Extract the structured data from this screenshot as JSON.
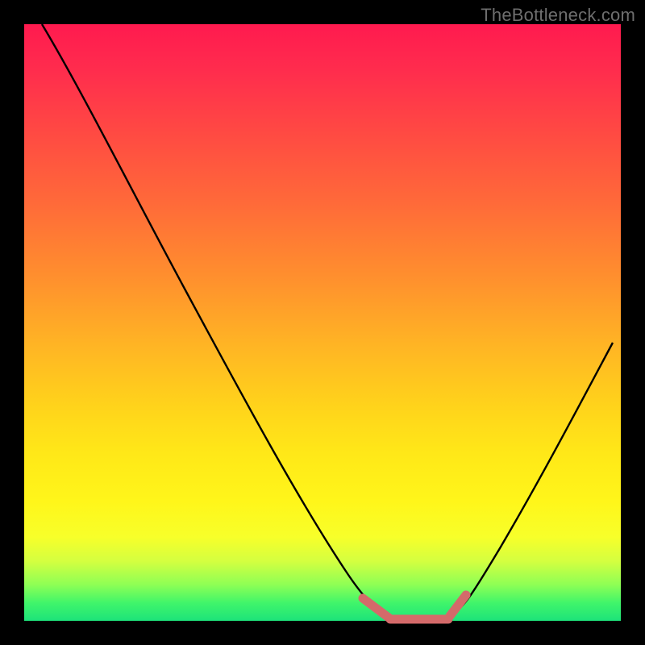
{
  "watermark": "TheBottleneck.com",
  "colors": {
    "curve": "#000000",
    "marker": "#d46a6a",
    "frame_bg": "#000000"
  },
  "chart_data": {
    "type": "line",
    "title": "",
    "xlabel": "",
    "ylabel": "",
    "xlim": [
      0,
      100
    ],
    "ylim": [
      0,
      100
    ],
    "series": [
      {
        "name": "bottleneck-curve",
        "x": [
          3,
          10,
          20,
          30,
          40,
          50,
          55,
          58,
          60,
          65,
          70,
          72,
          75,
          80,
          85,
          90,
          95,
          98
        ],
        "y": [
          100,
          87,
          72,
          57,
          42,
          27,
          17,
          9,
          3,
          0.5,
          0.5,
          3,
          9,
          21,
          33,
          45,
          55,
          62
        ]
      }
    ],
    "markers": [
      {
        "name": "left-marker",
        "x_range": [
          56,
          60
        ],
        "y_range": [
          3,
          9
        ]
      },
      {
        "name": "flat-marker",
        "x_range": [
          60,
          70
        ],
        "y_range": [
          0.5,
          0.5
        ]
      },
      {
        "name": "right-marker",
        "x_range": [
          70,
          73
        ],
        "y_range": [
          3,
          9
        ]
      }
    ],
    "grid": false,
    "legend": false
  }
}
